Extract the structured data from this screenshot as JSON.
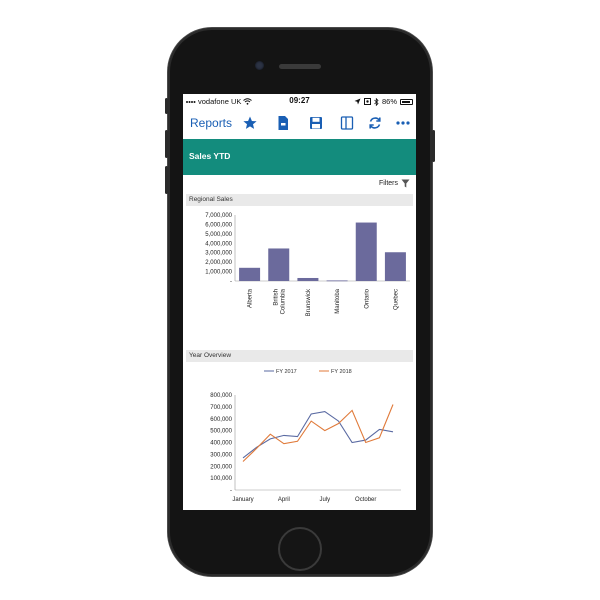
{
  "status_bar": {
    "carrier": "vodafone UK",
    "time": "09:27",
    "battery": "86%",
    "battery_fraction": 0.86
  },
  "toolbar": {
    "reports_label": "Reports",
    "icons": [
      "star-icon",
      "document-icon",
      "save-icon",
      "panel-icon",
      "refresh-icon",
      "more-icon"
    ]
  },
  "header": {
    "title": "Sales YTD"
  },
  "filters": {
    "label": "Filters"
  },
  "colors": {
    "accent": "#138c7d",
    "bar": "#6b6a9c",
    "fy2017": "#5a6aa2",
    "fy2018": "#e07a3a",
    "link": "#1a5fb4"
  },
  "regional_panel": {
    "title": "Regional Sales"
  },
  "overview_panel": {
    "title": "Year Overview"
  },
  "chart_data": [
    {
      "type": "bar",
      "categories": [
        "Alberta",
        "British Columbia",
        "Brunswick",
        "Manitoba",
        "Ontario",
        "Quebec"
      ],
      "category_lines": [
        [
          "Alberta"
        ],
        [
          "British",
          "Columbia"
        ],
        [
          "Brunswick"
        ],
        [
          "Manitoba"
        ],
        [
          "Ontario"
        ],
        [
          "Quebec"
        ]
      ],
      "values": [
        1400000,
        3450000,
        320000,
        60000,
        6200000,
        3050000
      ],
      "yticks": [
        0,
        1000000,
        2000000,
        3000000,
        4000000,
        5000000,
        6000000,
        7000000
      ],
      "ytick_labels": [
        "-",
        "1,000,000",
        "2,000,000",
        "3,000,000",
        "4,000,000",
        "5,000,000",
        "6,000,000",
        "7,000,000"
      ],
      "ylim": [
        0,
        7000000
      ],
      "grid": false
    },
    {
      "type": "line",
      "x": [
        "January",
        "February",
        "March",
        "April",
        "May",
        "June",
        "July",
        "August",
        "September",
        "October",
        "November",
        "December"
      ],
      "xtick_labels": [
        "January",
        "April",
        "July",
        "October"
      ],
      "xtick_index": [
        0,
        3,
        6,
        9
      ],
      "series": [
        {
          "name": "FY 2017",
          "values": [
            270000,
            360000,
            430000,
            460000,
            450000,
            640000,
            660000,
            580000,
            400000,
            420000,
            510000,
            490000
          ]
        },
        {
          "name": "FY 2018",
          "values": [
            240000,
            350000,
            470000,
            390000,
            410000,
            580000,
            500000,
            560000,
            670000,
            400000,
            440000,
            720000
          ]
        }
      ],
      "yticks": [
        0,
        100000,
        200000,
        300000,
        400000,
        500000,
        600000,
        700000,
        800000
      ],
      "ytick_labels": [
        "-",
        "100,000",
        "200,000",
        "300,000",
        "400,000",
        "500,000",
        "600,000",
        "700,000",
        "800,000"
      ],
      "ylim": [
        0,
        800000
      ],
      "legend": "top",
      "grid": false
    }
  ]
}
